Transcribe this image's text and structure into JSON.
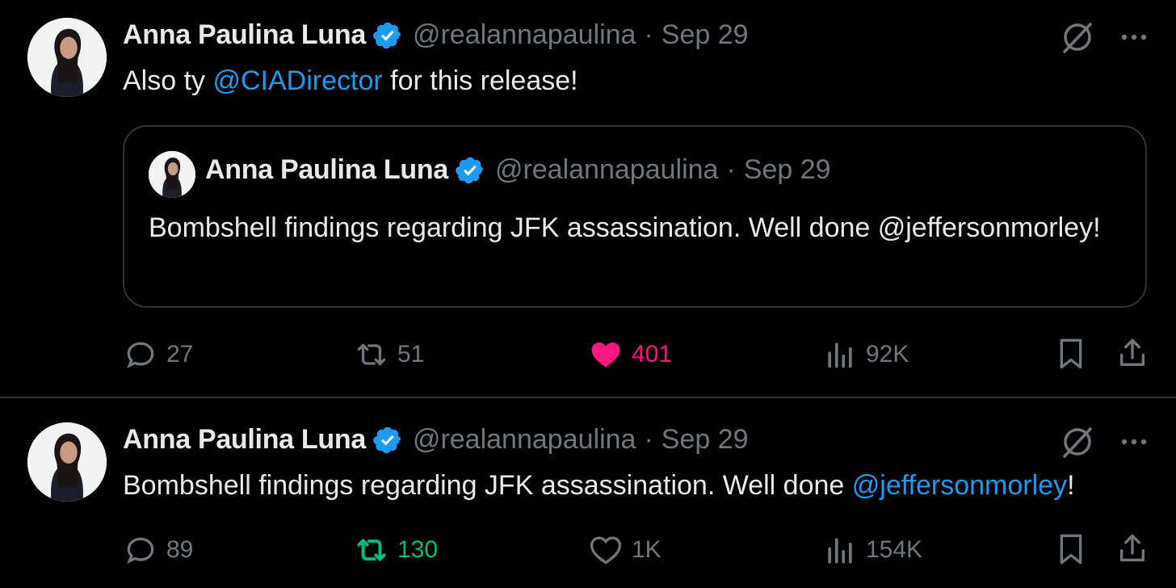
{
  "colors": {
    "background": "#000000",
    "text": "#e7e9ea",
    "muted": "#71767b",
    "link": "#1d9bf0",
    "verified": "#1d9bf0",
    "like_active": "#f91880",
    "retweet_active": "#00ba7c",
    "divider": "#2f3336"
  },
  "tweets": [
    {
      "author": {
        "name": "Anna Paulina Luna",
        "handle": "@realannapaulina",
        "verified": true
      },
      "dot": "·",
      "date": "Sep 29",
      "text_before": "Also ty ",
      "mention": "@CIADirector",
      "text_after": " for this release!",
      "quote": {
        "author": {
          "name": "Anna Paulina Luna",
          "handle": "@realannapaulina"
        },
        "dot": "·",
        "date": "Sep 29",
        "text": "Bombshell findings regarding JFK assassination. Well done @jeffersonmorley!"
      },
      "actions": {
        "replies": "27",
        "retweets": "51",
        "likes": "401",
        "views": "92K",
        "liked": true,
        "retweeted": false
      }
    },
    {
      "author": {
        "name": "Anna Paulina Luna",
        "handle": "@realannapaulina",
        "verified": true
      },
      "dot": "·",
      "date": "Sep 29",
      "text_before": "Bombshell findings regarding JFK assassination. Well done ",
      "mention": "@jeffersonmorley",
      "text_after": "!",
      "actions": {
        "replies": "89",
        "retweets": "130",
        "likes": "1K",
        "views": "154K",
        "liked": false,
        "retweeted": true
      }
    }
  ],
  "icons": {
    "reply": "reply-icon",
    "retweet": "retweet-icon",
    "like": "heart-icon",
    "views": "analytics-icon",
    "bookmark": "bookmark-icon",
    "share": "share-icon",
    "grok": "grok-icon",
    "more": "more-icon",
    "verified": "verified-badge-icon"
  }
}
